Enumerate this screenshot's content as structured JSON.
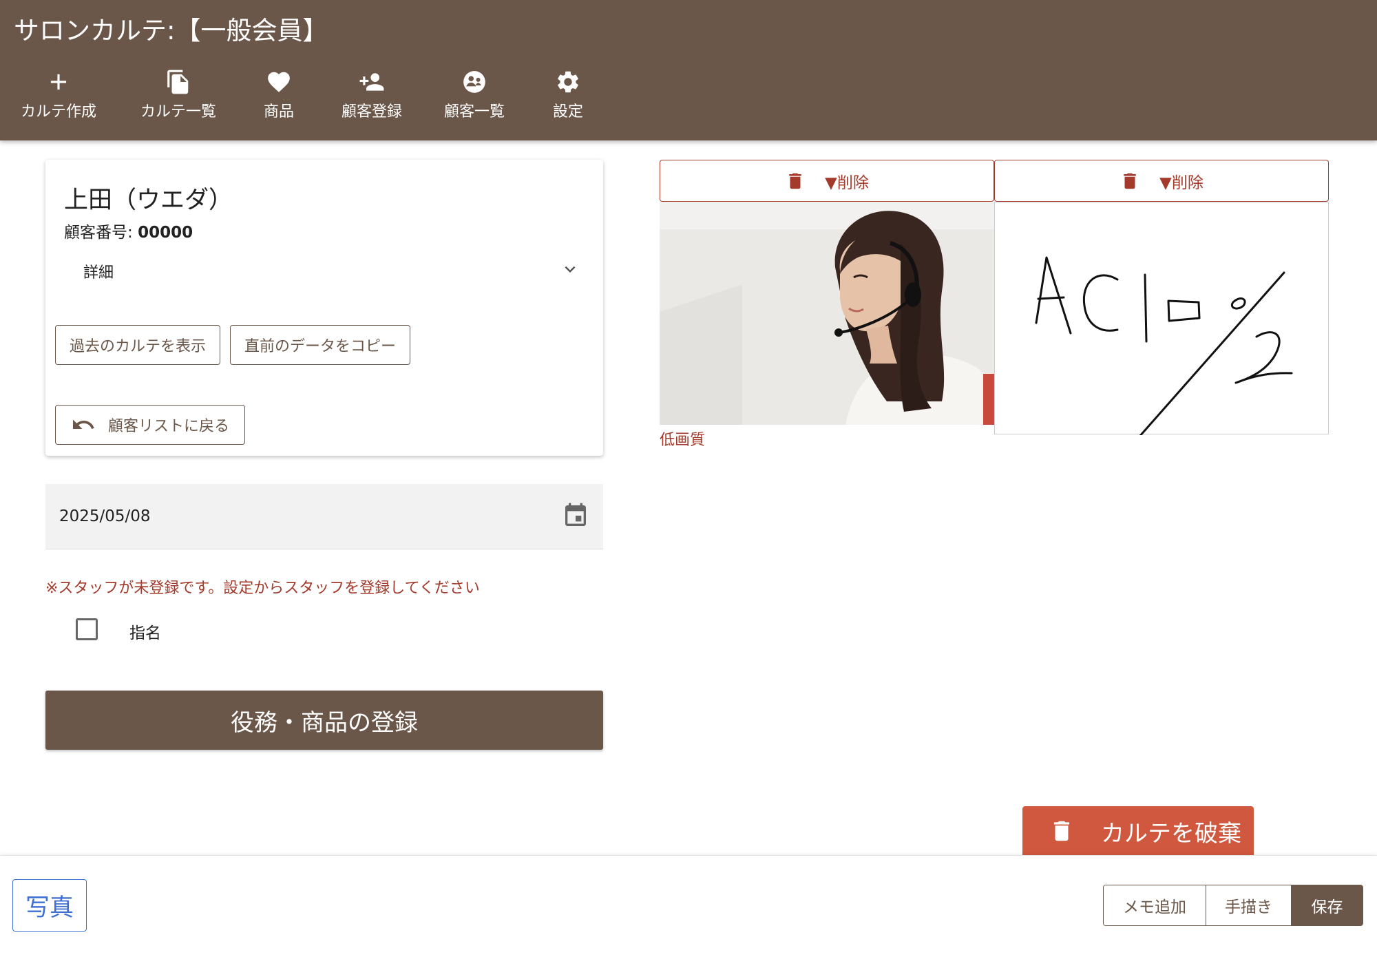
{
  "header": {
    "title": "サロンカルテ:【一般会員】",
    "nav": [
      {
        "icon": "plus-icon",
        "label": "カルテ作成"
      },
      {
        "icon": "copy-icon",
        "label": "カルテ一覧"
      },
      {
        "icon": "heart-icon",
        "label": "商品"
      },
      {
        "icon": "person-add-icon",
        "label": "顧客登録"
      },
      {
        "icon": "customers-icon",
        "label": "顧客一覧"
      },
      {
        "icon": "gear-icon",
        "label": "設定"
      }
    ]
  },
  "customer": {
    "name": "上田（ウエダ）",
    "number_label": "顧客番号:",
    "number": "00000",
    "detail_label": "詳細",
    "show_past_label": "過去のカルテを表示",
    "copy_prev_label": "直前のデータをコピー",
    "back_label": "顧客リストに戻る"
  },
  "date": {
    "value": "2025/05/08"
  },
  "staff": {
    "warning": "※スタッフが未登録です。設定からスタッフを登録してください",
    "nominated_label": "指名",
    "nominated_checked": false
  },
  "register_button": "役務・商品の登録",
  "media": {
    "items": [
      {
        "delete_label": "▼削除",
        "caption": "低画質"
      },
      {
        "delete_label": "▼削除"
      }
    ]
  },
  "discard_button": "カルテを破棄",
  "bottom": {
    "photo_label": "写真",
    "memo_label": "メモ追加",
    "handwrite_label": "手描き",
    "save_label": "保存"
  },
  "colors": {
    "brand": "#6b5749",
    "danger": "#a33a2b",
    "discard": "#d0583e",
    "link": "#3f6fd2"
  }
}
